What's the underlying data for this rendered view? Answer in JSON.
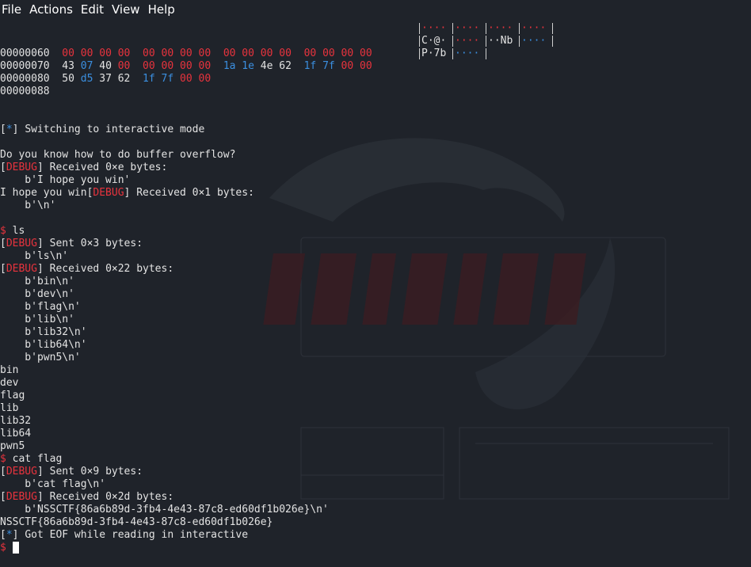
{
  "menu": [
    "File",
    "Actions",
    "Edit",
    "View",
    "Help"
  ],
  "hexdump": [
    {
      "addr": "00000060",
      "bytes": [
        [
          "00",
          "red"
        ],
        [
          "00",
          "red"
        ],
        [
          "00",
          "red"
        ],
        [
          "00",
          "red"
        ],
        [
          "00",
          "red"
        ],
        [
          "00",
          "red"
        ],
        [
          "00",
          "red"
        ],
        [
          "00",
          "red"
        ],
        [
          "00",
          "red"
        ],
        [
          "00",
          "red"
        ],
        [
          "00",
          "red"
        ],
        [
          "00",
          "red"
        ],
        [
          "00",
          "red"
        ],
        [
          "00",
          "red"
        ],
        [
          "00",
          "red"
        ],
        [
          "00",
          "red"
        ]
      ]
    },
    {
      "addr": "00000070",
      "bytes": [
        [
          "43",
          "white"
        ],
        [
          "07",
          "blue"
        ],
        [
          "40",
          "white"
        ],
        [
          "00",
          "red"
        ],
        [
          "00",
          "red"
        ],
        [
          "00",
          "red"
        ],
        [
          "00",
          "red"
        ],
        [
          "00",
          "red"
        ],
        [
          "1a",
          "blue"
        ],
        [
          "1e",
          "blue"
        ],
        [
          "4e",
          "white"
        ],
        [
          "62",
          "white"
        ],
        [
          "1f",
          "blue"
        ],
        [
          "7f",
          "blue"
        ],
        [
          "00",
          "red"
        ],
        [
          "00",
          "red"
        ]
      ]
    },
    {
      "addr": "00000080",
      "bytes": [
        [
          "50",
          "white"
        ],
        [
          "d5",
          "blue"
        ],
        [
          "37",
          "white"
        ],
        [
          "62",
          "white"
        ],
        [
          "1f",
          "blue"
        ],
        [
          "7f",
          "blue"
        ],
        [
          "00",
          "red"
        ],
        [
          "00",
          "red"
        ]
      ]
    },
    {
      "addr": "00000088",
      "bytes": []
    }
  ],
  "ascii": [
    [
      [
        "····",
        "red"
      ],
      [
        "····",
        "red"
      ],
      [
        "····",
        "red"
      ],
      [
        "····",
        "red"
      ]
    ],
    [
      [
        "C·@·",
        "white"
      ],
      [
        "····",
        "red"
      ],
      [
        "··Nb",
        "white"
      ],
      [
        "····",
        "blue"
      ]
    ],
    [
      [
        "P·7b",
        "white"
      ],
      [
        "····",
        "blue"
      ]
    ]
  ],
  "lines": [
    {
      "type": "info",
      "text": "Switching to interactive mode"
    },
    {
      "type": "plain",
      "text": ""
    },
    {
      "type": "plain",
      "text": "Do you know how to do buffer overflow?"
    },
    {
      "type": "debug",
      "text": "Received 0×e bytes:"
    },
    {
      "type": "plain",
      "text": "    b'I hope you win'"
    },
    {
      "type": "mixdebug",
      "pre": "I hope you win",
      "text": "Received 0×1 bytes:"
    },
    {
      "type": "plain",
      "text": "    b'\\n'"
    },
    {
      "type": "plain",
      "text": ""
    },
    {
      "type": "prompt",
      "text": "ls"
    },
    {
      "type": "debug",
      "text": "Sent 0×3 bytes:"
    },
    {
      "type": "plain",
      "text": "    b'ls\\n'"
    },
    {
      "type": "debug",
      "text": "Received 0×22 bytes:"
    },
    {
      "type": "plain",
      "text": "    b'bin\\n'"
    },
    {
      "type": "plain",
      "text": "    b'dev\\n'"
    },
    {
      "type": "plain",
      "text": "    b'flag\\n'"
    },
    {
      "type": "plain",
      "text": "    b'lib\\n'"
    },
    {
      "type": "plain",
      "text": "    b'lib32\\n'"
    },
    {
      "type": "plain",
      "text": "    b'lib64\\n'"
    },
    {
      "type": "plain",
      "text": "    b'pwn5\\n'"
    },
    {
      "type": "plain",
      "text": "bin"
    },
    {
      "type": "plain",
      "text": "dev"
    },
    {
      "type": "plain",
      "text": "flag"
    },
    {
      "type": "plain",
      "text": "lib"
    },
    {
      "type": "plain",
      "text": "lib32"
    },
    {
      "type": "plain",
      "text": "lib64"
    },
    {
      "type": "plain",
      "text": "pwn5"
    },
    {
      "type": "prompt",
      "text": "cat flag"
    },
    {
      "type": "debug",
      "text": "Sent 0×9 bytes:"
    },
    {
      "type": "plain",
      "text": "    b'cat flag\\n'"
    },
    {
      "type": "debug",
      "text": "Received 0×2d bytes:"
    },
    {
      "type": "plain",
      "text": "    b'NSSCTF{86a6b89d-3fb4-4e43-87c8-ed60df1b026e}\\n'"
    },
    {
      "type": "plain",
      "text": "NSSCTF{86a6b89d-3fb4-4e43-87c8-ed60df1b026e}"
    },
    {
      "type": "info",
      "text": "Got EOF while reading in interactive"
    },
    {
      "type": "cursor",
      "text": ""
    }
  ],
  "labels": {
    "info_marker": "*",
    "debug_marker": "DEBUG",
    "prompt_symbol": "$"
  },
  "colors": {
    "background": "#1f232a",
    "text": "#e3e3e3",
    "red": "#e8333d",
    "blue": "#3b8fe0"
  }
}
